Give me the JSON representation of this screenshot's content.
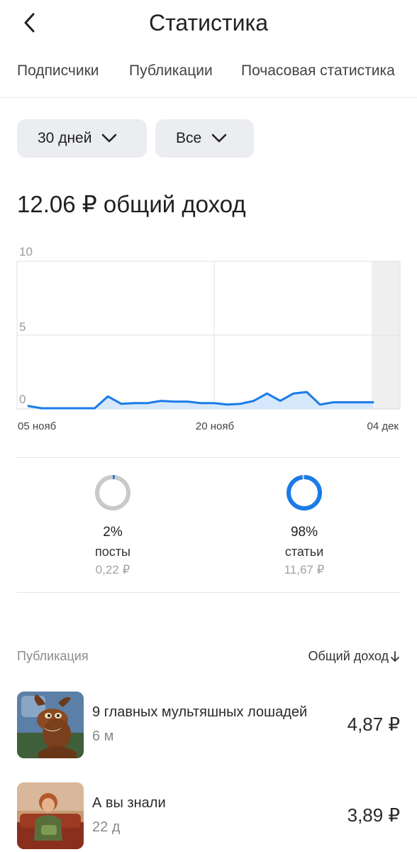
{
  "header": {
    "title": "Статистика"
  },
  "tabs": [
    {
      "label": "Подписчики"
    },
    {
      "label": "Публикации"
    },
    {
      "label": "Почасовая статистика"
    }
  ],
  "filters": {
    "period": "30 дней",
    "type": "Все"
  },
  "summary": {
    "total_income": "12.06 ₽ общий доход"
  },
  "chart_data": {
    "type": "area",
    "title": "",
    "xlabel": "",
    "ylabel": "",
    "ylim": [
      0,
      10
    ],
    "yticks": [
      "10",
      "5",
      "0"
    ],
    "xticks": [
      "05 нояб",
      "20 нояб",
      "04 дек"
    ],
    "grid": true,
    "series": [
      {
        "values": [
          0.2,
          0.05,
          0.05,
          0.05,
          0.05,
          0.05,
          0.85,
          0.35,
          0.4,
          0.4,
          0.55,
          0.5,
          0.5,
          0.4,
          0.4,
          0.3,
          0.35,
          0.55,
          1.05,
          0.55,
          1.05,
          1.15,
          0.3,
          0.45,
          0.45,
          0.45,
          0.45
        ]
      }
    ],
    "line_color": "#1a7be8",
    "fill_color": "#d6e8fb"
  },
  "breakdown": [
    {
      "percent": "2%",
      "label": "посты",
      "amount": "0,22 ₽",
      "share": 0.02
    },
    {
      "percent": "98%",
      "label": "статьи",
      "amount": "11,67 ₽",
      "share": 0.98
    }
  ],
  "ring_colors": {
    "accent": "#1a7be8",
    "track": "#c9c9c9"
  },
  "list": {
    "col_publication": "Публикация",
    "col_income": "Общий доход",
    "items": [
      {
        "title": "9 главных мультяшных лошадей",
        "age": "6 м",
        "income": "4,87 ₽"
      },
      {
        "title": "А вы знали",
        "age": "22 д",
        "income": "3,89 ₽"
      }
    ]
  }
}
